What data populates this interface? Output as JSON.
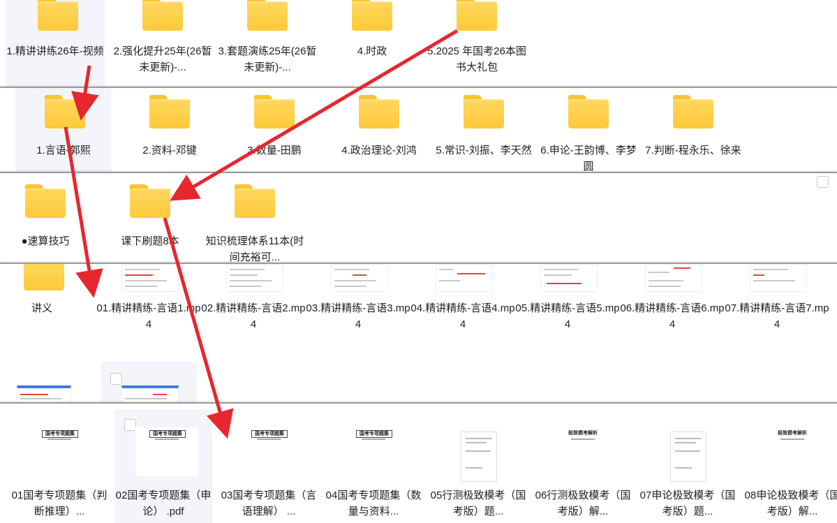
{
  "row1": [
    "1.精讲讲练26年-视频",
    "2.强化提升25年(26暂未更新)-...",
    "3.套题演练25年(26暂未更新)-...",
    "4.时政",
    "5.2025 年国考26本图书大礼包"
  ],
  "row2": [
    "1.言语-郭熙",
    "2.资料-邓键",
    "3.数量-田鹏",
    "4.政治理论-刘鸿",
    "5.常识-刘振、李天然",
    "6.申论-王韵博、李梦圆",
    "7.判断-程永乐、徐来"
  ],
  "row3": [
    "●速算技巧",
    "课下刷题8本",
    "知识梳理体系11本(时间充裕可..."
  ],
  "row4": [
    "讲义",
    "01.精讲精练-言语1.mp4",
    "02.精讲精练-言语2.mp4",
    "03.精讲精练-言语3.mp4",
    "04.精讲精练-言语4.mp4",
    "05.精讲精练-言语5.mp4",
    "06.精讲精练-言语6.mp4",
    "07.精讲精练-言语7.mp4"
  ],
  "row5": [
    "01国考专项题集（判断推理）...",
    "02国考专项题集（申论） .pdf",
    "03国考专项题集（言语理解） ...",
    "04国考专项题集（数量与资料...",
    "05行测极致模考（国考版）题...",
    "06行测极致模考（国考版）解...",
    "07申论极致模考（国考版）题...",
    "08申论极致模考（国考版）解..."
  ],
  "doc_headers": [
    "国考专项题集",
    "国考专项题集",
    "国考专项题集",
    "国考专项题集",
    "",
    "极致模考解析",
    "",
    "极致模考解析"
  ],
  "colors": {
    "arrow": "#e8262d",
    "folder": "#ffc93a"
  }
}
